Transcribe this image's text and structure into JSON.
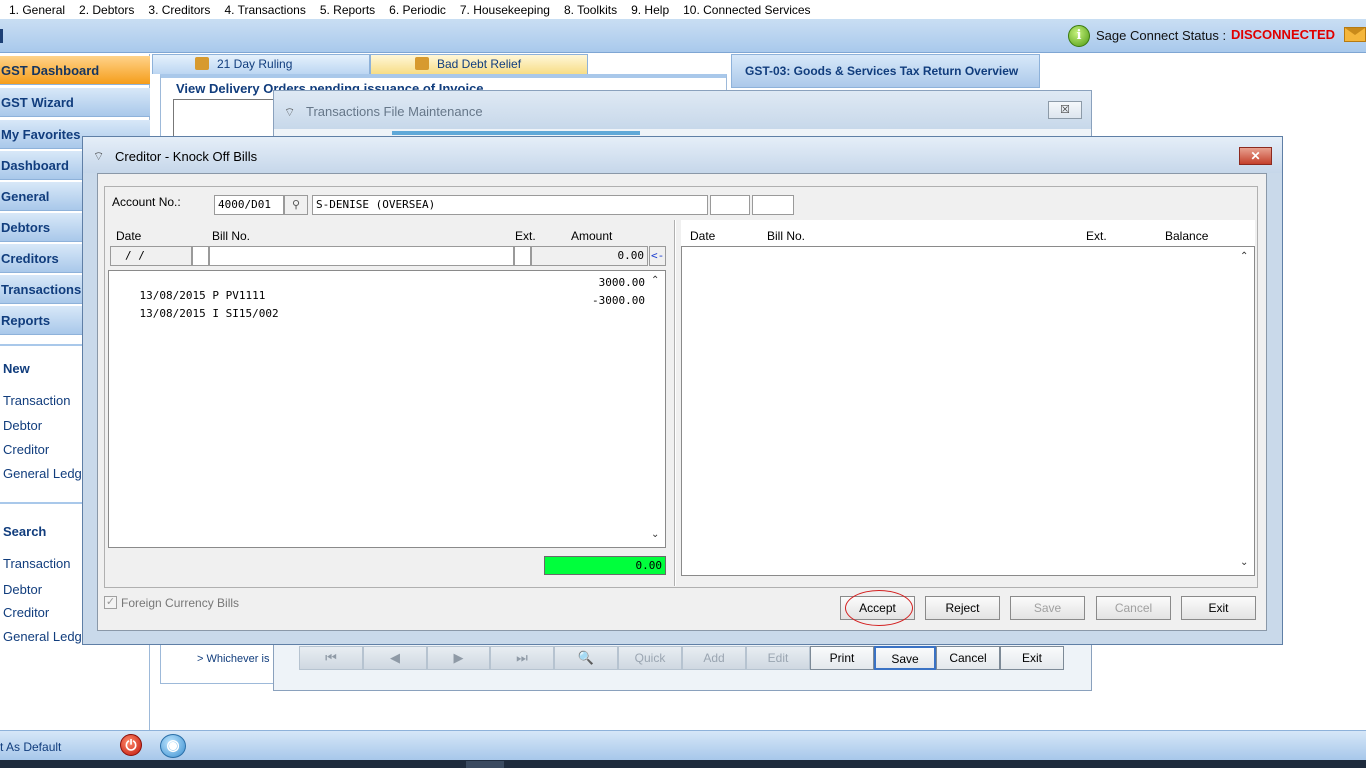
{
  "menu": [
    "1. General",
    "2. Debtors",
    "3. Creditors",
    "4. Transactions",
    "5. Reports",
    "6. Periodic",
    "7. Housekeeping",
    "8. Toolkits",
    "9. Help",
    "10. Connected Services"
  ],
  "status": {
    "label": "Sage Connect Status :",
    "value": "DISCONNECTED",
    "info_icon": "i"
  },
  "sidebar": {
    "items": [
      "GST Dashboard",
      "GST Wizard",
      "My Favorites",
      "Dashboard",
      "General",
      "Debtors",
      "Creditors",
      "Transactions",
      "Reports"
    ],
    "new_heading": "New",
    "new_links": [
      "Transaction",
      "Debtor",
      "Creditor",
      "General Ledg"
    ],
    "search_heading": "Search",
    "search_links": [
      "Transaction",
      "Debtor",
      "Creditor",
      "General Ledg"
    ],
    "set_default": "t As Default"
  },
  "tabs": {
    "day_ruling": "21 Day Ruling",
    "bad_debt": "Bad Debt Relief",
    "gst03": "GST-03: Goods & Services Tax Return Overview"
  },
  "left_panel": {
    "heading": "View Delivery Orders pending issuance of Invoice",
    "note": "> Whichever is e"
  },
  "tfm": {
    "title": "Transactions File Maintenance",
    "close": "☒",
    "toolbar": [
      "⏮",
      "◀",
      "▶",
      "⏭",
      "🔍",
      "Quick",
      "Add",
      "Edit",
      "Print",
      "Save",
      "Cancel",
      "Exit"
    ]
  },
  "knockoff": {
    "title": "Creditor - Knock Off Bills",
    "close": "✕",
    "account_label": "Account No.:",
    "account_no": "4000/D01",
    "account_name": "S-DENISE (OVERSEA)",
    "left_headers": {
      "date": "Date",
      "bill": "Bill No.",
      "ext": "Ext.",
      "amount": "Amount"
    },
    "right_headers": {
      "date": "Date",
      "bill": "Bill No.",
      "ext": "Ext.",
      "balance": "Balance"
    },
    "input_date": " /  /",
    "input_amount": "0.00",
    "arrow": "<-",
    "bills": [
      {
        "date": "13/08/2015",
        "type": "P",
        "bill": "PV1111",
        "amount": "3000.00"
      },
      {
        "date": "13/08/2015",
        "type": "I",
        "bill": "SI15/002",
        "amount": "-3000.00"
      }
    ],
    "total": "0.00",
    "foreign_currency": "Foreign Currency Bills",
    "buttons": {
      "accept": "Accept",
      "reject": "Reject",
      "save": "Save",
      "cancel": "Cancel",
      "exit": "Exit"
    }
  }
}
